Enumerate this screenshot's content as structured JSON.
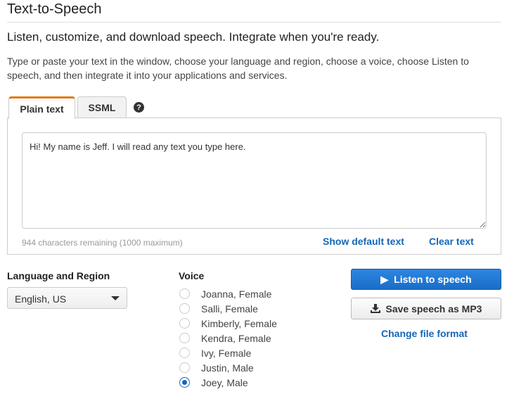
{
  "header": {
    "title": "Text-to-Speech",
    "subtitle": "Listen, customize, and download speech. Integrate when you're ready.",
    "description": "Type or paste your text in the window, choose your language and region, choose a voice, choose Listen to speech, and then integrate it into your applications and services."
  },
  "tabs": [
    {
      "label": "Plain text",
      "active": true
    },
    {
      "label": "SSML",
      "active": false
    }
  ],
  "help_icon": "?",
  "editor": {
    "value": "Hi! My name is Jeff. I will read any text you type here.",
    "char_count": "944 characters remaining (1000 maximum)",
    "show_default": "Show default text",
    "clear": "Clear text"
  },
  "language": {
    "label": "Language and Region",
    "selected": "English, US"
  },
  "voice": {
    "label": "Voice",
    "options": [
      "Joanna, Female",
      "Salli, Female",
      "Kimberly, Female",
      "Kendra, Female",
      "Ivy, Female",
      "Justin, Male",
      "Joey, Male"
    ],
    "selected": "Joey, Male"
  },
  "actions": {
    "listen": "Listen to speech",
    "save": "Save speech as MP3",
    "change_format": "Change file format"
  },
  "colors": {
    "accent": "#1466b8",
    "tab_highlight": "#e47911"
  }
}
